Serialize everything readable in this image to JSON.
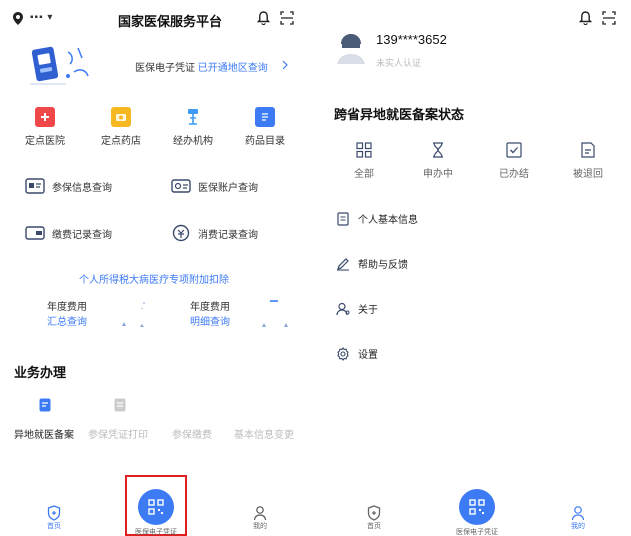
{
  "left": {
    "header": {
      "region": "▪▪▪ ▾",
      "title": "国家医保服务平台"
    },
    "banner": {
      "label": "医保电子凭证",
      "link": "已开通地区查询"
    },
    "services": [
      {
        "label": "定点医院",
        "icon": "hospital-icon",
        "color": "#f04848"
      },
      {
        "label": "定点药店",
        "icon": "pharmacy-icon",
        "color": "#f5b820"
      },
      {
        "label": "经办机构",
        "icon": "agency-icon",
        "color": "#3d9bf5"
      },
      {
        "label": "药品目录",
        "icon": "drug-catalog-icon",
        "color": "#3d7bf5"
      }
    ],
    "queries": [
      {
        "label": "参保信息查询",
        "icon": "insured-info-icon"
      },
      {
        "label": "医保账户查询",
        "icon": "account-icon"
      },
      {
        "label": "缴费记录查询",
        "icon": "payment-record-icon"
      },
      {
        "label": "消费记录查询",
        "icon": "consumption-record-icon"
      }
    ],
    "tax_link": "个人所得税大病医疗专项附加扣除",
    "stats": [
      {
        "line1": "年度费用",
        "line2": "汇总查询"
      },
      {
        "line1": "年度费用",
        "line2": "明细查询"
      }
    ],
    "business": {
      "title": "业务办理",
      "items": [
        {
          "label": "异地就医备案",
          "dim": false
        },
        {
          "label": "参保凭证打印",
          "dim": true
        },
        {
          "label": "参保缴费",
          "dim": true
        },
        {
          "label": "基本信息变更",
          "dim": true
        }
      ]
    },
    "tabs": [
      {
        "label": "首页",
        "active": true
      },
      {
        "label": "医保电子凭证",
        "active": false
      },
      {
        "label": "我的",
        "active": false
      }
    ]
  },
  "right": {
    "profile": {
      "phone": "139****3652",
      "verify": "未实人认证"
    },
    "filing": {
      "title": "跨省异地就医备案状态",
      "statuses": [
        {
          "label": "全部",
          "icon": "grid-icon"
        },
        {
          "label": "申办中",
          "icon": "hourglass-icon"
        },
        {
          "label": "已办结",
          "icon": "check-box-icon"
        },
        {
          "label": "被退回",
          "icon": "returned-icon"
        }
      ]
    },
    "menu": [
      {
        "label": "个人基本信息",
        "icon": "personal-info-icon"
      },
      {
        "label": "帮助与反馈",
        "icon": "help-feedback-icon"
      },
      {
        "label": "关于",
        "icon": "about-icon"
      },
      {
        "label": "设置",
        "icon": "settings-icon"
      }
    ],
    "tabs": [
      {
        "label": "首页",
        "active": false
      },
      {
        "label": "医保电子凭证",
        "active": false
      },
      {
        "label": "我的",
        "active": true
      }
    ]
  },
  "colors": {
    "accent": "#3d7bf5",
    "highlight_border": "#e02020"
  }
}
